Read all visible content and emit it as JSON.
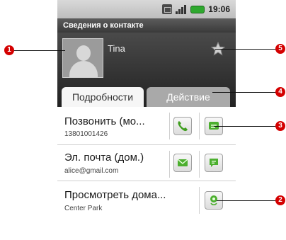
{
  "statusbar": {
    "time": "19:06"
  },
  "title_bar": {
    "title": "Сведения о контакте"
  },
  "contact": {
    "name": "Tina"
  },
  "tabs": [
    {
      "label": "Подробности",
      "selected": true
    },
    {
      "label": "Действие",
      "selected": false
    }
  ],
  "rows": [
    {
      "title": "Позвонить (мо...",
      "subtitle": "13801001426"
    },
    {
      "title": "Эл. почта (дом.)",
      "subtitle": "alice@gmail.com"
    },
    {
      "title": "Просмотреть дома...",
      "subtitle": "Center Park"
    }
  ],
  "callouts": [
    "1",
    "2",
    "3",
    "4",
    "5"
  ],
  "colors": {
    "callout": "#d40000",
    "header": "#2a2a2a",
    "action_green": "#4caf2f"
  }
}
